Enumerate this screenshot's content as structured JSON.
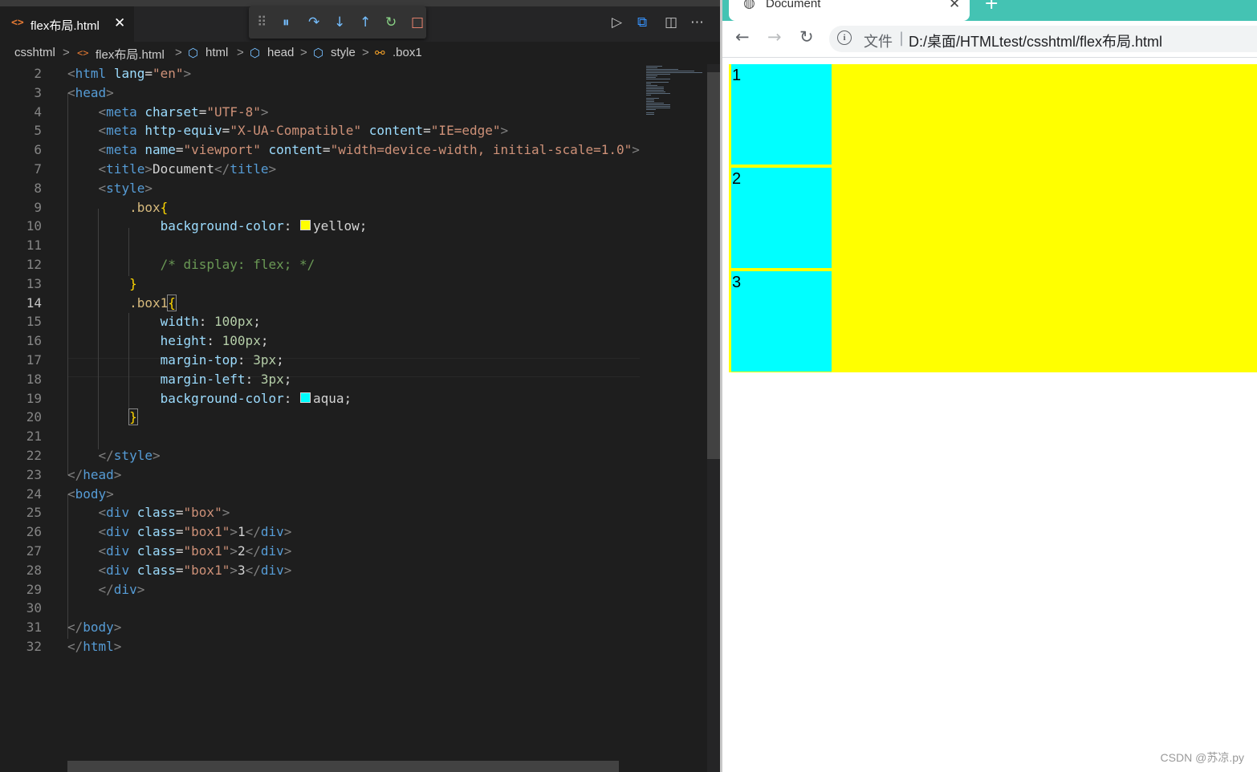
{
  "editor": {
    "tab": {
      "icon": "html-file-icon",
      "label": "flex布局.html",
      "close": "✕"
    },
    "debug_toolbar": [
      {
        "name": "drag-handle-icon",
        "glyph": "⠿",
        "color": "#858585"
      },
      {
        "name": "pause-icon",
        "glyph": "⏸",
        "color": "#75beff"
      },
      {
        "name": "step-over-icon",
        "glyph": "↷",
        "color": "#75beff"
      },
      {
        "name": "step-into-icon",
        "glyph": "↓",
        "color": "#75beff"
      },
      {
        "name": "step-out-icon",
        "glyph": "↑",
        "color": "#75beff"
      },
      {
        "name": "restart-icon",
        "glyph": "↻",
        "color": "#89d185"
      },
      {
        "name": "stop-icon",
        "glyph": "□",
        "color": "#f48771"
      }
    ],
    "toolbar_right": {
      "run": "▷",
      "preview": "⧉",
      "split": "◫",
      "more": "⋯"
    },
    "breadcrumb": {
      "folder": "csshtml",
      "file": "flex布局.html",
      "html": "html",
      "head": "head",
      "style": "style",
      "selector": ".box1",
      "sep": ">"
    },
    "lines": [
      {
        "n": "2",
        "t": "html_open"
      },
      {
        "n": "3",
        "t": "head_open"
      },
      {
        "n": "4",
        "t": "meta1"
      },
      {
        "n": "5",
        "t": "meta2"
      },
      {
        "n": "6",
        "t": "meta3"
      },
      {
        "n": "7",
        "t": "title"
      },
      {
        "n": "8",
        "t": "style_open"
      },
      {
        "n": "9",
        "t": "box_sel"
      },
      {
        "n": "10",
        "t": "box_bg"
      },
      {
        "n": "11",
        "t": "blank"
      },
      {
        "n": "12",
        "t": "comment"
      },
      {
        "n": "13",
        "t": "close_brace"
      },
      {
        "n": "14",
        "t": "box1_sel"
      },
      {
        "n": "15",
        "t": "width"
      },
      {
        "n": "16",
        "t": "height"
      },
      {
        "n": "17",
        "t": "margin_top"
      },
      {
        "n": "18",
        "t": "margin_left"
      },
      {
        "n": "19",
        "t": "aqua_bg"
      },
      {
        "n": "20",
        "t": "close_brace2"
      },
      {
        "n": "21",
        "t": "blank"
      },
      {
        "n": "22",
        "t": "style_close"
      },
      {
        "n": "23",
        "t": "head_close"
      },
      {
        "n": "24",
        "t": "body_open"
      },
      {
        "n": "25",
        "t": "div_box"
      },
      {
        "n": "26",
        "t": "div1"
      },
      {
        "n": "27",
        "t": "div2"
      },
      {
        "n": "28",
        "t": "div3"
      },
      {
        "n": "29",
        "t": "div_close"
      },
      {
        "n": "30",
        "t": "blank"
      },
      {
        "n": "31",
        "t": "body_close"
      },
      {
        "n": "32",
        "t": "html_close"
      }
    ],
    "current_line": "14",
    "colors": {
      "yellow_swatch": "#ffff00",
      "aqua_swatch": "#00ffff"
    }
  },
  "browser": {
    "tab_title": "Document",
    "tab_close": "✕",
    "new_tab": "+",
    "nav": {
      "back": "←",
      "forward": "→",
      "reload": "↻"
    },
    "info_icon": "i",
    "file_label": "文件",
    "url_sep": "|",
    "url": "D:/桌面/HTMLtest/csshtml/flex布局.html",
    "rendered": {
      "box_color": "#ffff00",
      "box1_color": "#00ffff",
      "items": [
        "1",
        "2",
        "3"
      ]
    }
  },
  "watermark": "CSDN @苏凉.py"
}
